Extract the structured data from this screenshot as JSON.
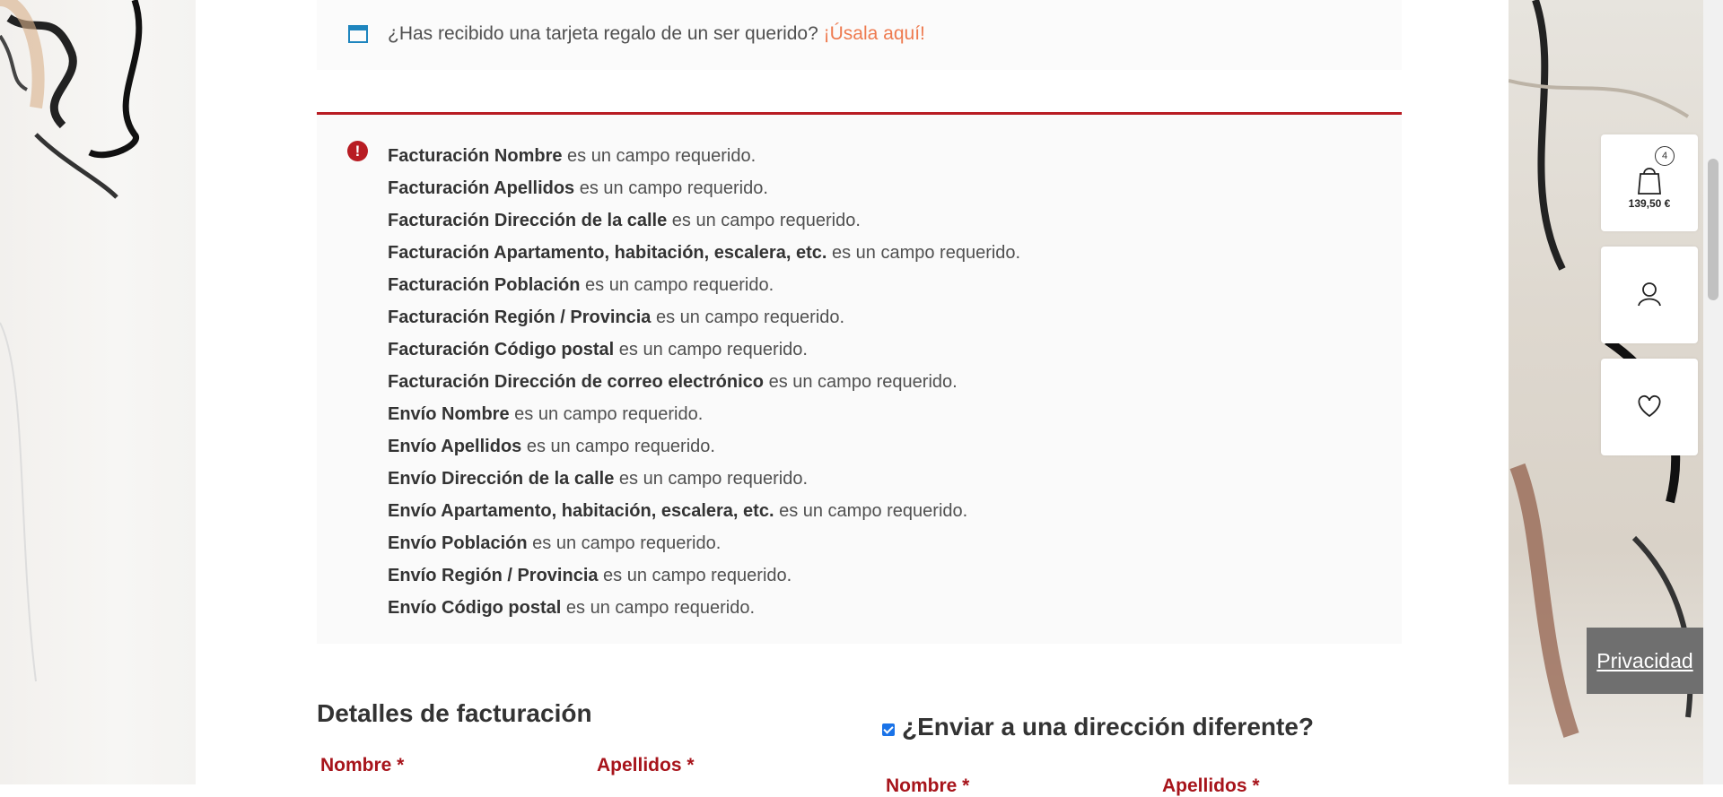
{
  "coupon": {
    "text": "¿Has recibido una tarjeta regalo de un ser querido?",
    "link": "¡Úsala aquí!"
  },
  "errors": [
    {
      "field": "Facturación Nombre",
      "message": "es un campo requerido."
    },
    {
      "field": "Facturación Apellidos",
      "message": "es un campo requerido."
    },
    {
      "field": "Facturación Dirección de la calle",
      "message": "es un campo requerido."
    },
    {
      "field": "Facturación Apartamento, habitación, escalera, etc.",
      "message": "es un campo requerido."
    },
    {
      "field": "Facturación Población",
      "message": "es un campo requerido."
    },
    {
      "field": "Facturación Región / Provincia",
      "message": "es un campo requerido."
    },
    {
      "field": "Facturación Código postal",
      "message": "es un campo requerido."
    },
    {
      "field": "Facturación Dirección de correo electrónico",
      "message": "es un campo requerido."
    },
    {
      "field": "Envío Nombre",
      "message": "es un campo requerido."
    },
    {
      "field": "Envío Apellidos",
      "message": "es un campo requerido."
    },
    {
      "field": "Envío Dirección de la calle",
      "message": "es un campo requerido."
    },
    {
      "field": "Envío Apartamento, habitación, escalera, etc.",
      "message": "es un campo requerido."
    },
    {
      "field": "Envío Población",
      "message": "es un campo requerido."
    },
    {
      "field": "Envío Región / Provincia",
      "message": "es un campo requerido."
    },
    {
      "field": "Envío Código postal",
      "message": "es un campo requerido."
    }
  ],
  "billing": {
    "title": "Detalles de facturación",
    "first_name_label": "Nombre *",
    "last_name_label": "Apellidos *"
  },
  "shipping": {
    "toggle_label": "¿Enviar a una dirección diferente?",
    "checked": true,
    "first_name_label": "Nombre *",
    "last_name_label": "Apellidos *"
  },
  "side_panel": {
    "cart_count": "4",
    "cart_total": "139,50 €"
  },
  "privacy_label": "Privacidad",
  "colors": {
    "error_accent": "#b81c23",
    "coupon_link": "#ee7a4f",
    "required_label": "#a7141b",
    "info_icon": "#1e85be"
  }
}
